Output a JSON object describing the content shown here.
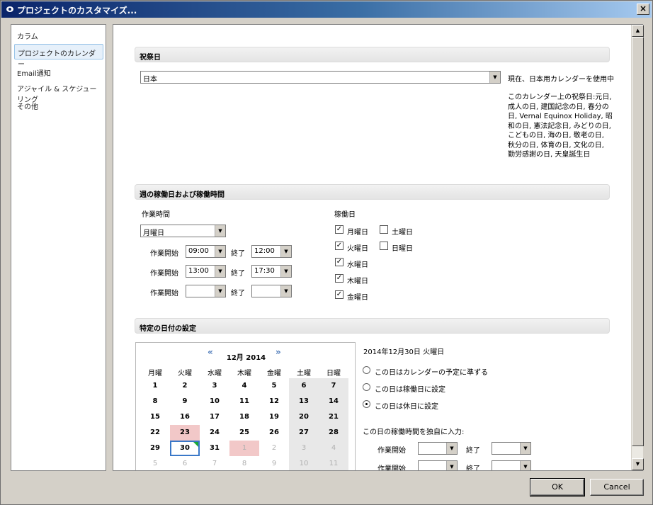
{
  "window": {
    "title": "プロジェクトのカスタマイズ...",
    "close": "×"
  },
  "sidebar": {
    "items": [
      {
        "label": "カラム"
      },
      {
        "label": "プロジェクトのカレンダー"
      },
      {
        "label": "Email通知"
      },
      {
        "label": "アジャイル & スケジューリング"
      },
      {
        "label": "その他"
      }
    ],
    "selected": 1
  },
  "holidays": {
    "header": "祝祭日",
    "country": "日本",
    "info_line1": "現在、日本用カレンダーを使用中",
    "info_body": "このカレンダー上の祝祭日:元日, 成人の日, 建国記念の日, 春分の日, Vernal Equinox Holiday, 昭和の日, 憲法記念日, みどりの日, こどもの日, 海の日, 敬老の日, 秋分の日, 体育の日, 文化の日, 勤労感謝の日, 天皇誕生日"
  },
  "workweek": {
    "header": "週の稼働日および稼働時間",
    "hours_label": "作業時間",
    "day_select": "月曜日",
    "start_label": "作業開始",
    "end_label": "終了",
    "rows": [
      {
        "start": "09:00",
        "end": "12:00"
      },
      {
        "start": "13:00",
        "end": "17:30"
      },
      {
        "start": "",
        "end": ""
      }
    ],
    "workdays_label": "稼働日",
    "days": [
      {
        "label": "月曜日",
        "checked": true
      },
      {
        "label": "土曜日",
        "checked": false
      },
      {
        "label": "火曜日",
        "checked": true
      },
      {
        "label": "日曜日",
        "checked": false
      },
      {
        "label": "水曜日",
        "checked": true
      },
      {
        "label": "木曜日",
        "checked": true
      },
      {
        "label": "金曜日",
        "checked": true
      }
    ]
  },
  "specific": {
    "header": "特定の日付の設定",
    "selected_date": "2014年12月30日 火曜日",
    "options": [
      {
        "label": "この日はカレンダーの予定に準ずる",
        "checked": false
      },
      {
        "label": "この日は稼働日に設定",
        "checked": false
      },
      {
        "label": "この日は休日に設定",
        "checked": true
      }
    ],
    "custom_label": "この日の稼働時間を独自に入力:",
    "start_label": "作業開始",
    "end_label": "終了"
  },
  "calendar": {
    "title": "12月 2014",
    "prev": "«",
    "next": "»",
    "weekdays": [
      "月曜",
      "火曜",
      "水曜",
      "木曜",
      "金曜",
      "土曜",
      "日曜"
    ],
    "weeks": [
      [
        "1",
        "2",
        "3",
        "4",
        "5",
        "6",
        "7"
      ],
      [
        "8",
        "9",
        "10",
        "11",
        "12",
        "13",
        "14"
      ],
      [
        "15",
        "16",
        "17",
        "18",
        "19",
        "20",
        "21"
      ],
      [
        "22",
        "23",
        "24",
        "25",
        "26",
        "27",
        "28"
      ],
      [
        "29",
        "30",
        "31",
        "1",
        "2",
        "3",
        "4"
      ],
      [
        "5",
        "6",
        "7",
        "8",
        "9",
        "10",
        "11"
      ]
    ],
    "colors": {
      "weekend": "#e8e8e8",
      "holiday": "#f2c8c8",
      "selected": "#3a78c8"
    }
  },
  "buttons": {
    "ok": "OK",
    "cancel": "Cancel"
  }
}
